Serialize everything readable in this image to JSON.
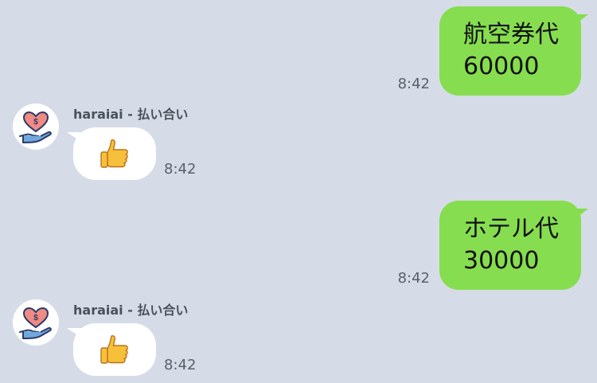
{
  "messages": [
    {
      "type": "outgoing",
      "line1": "航空券代",
      "line2": "60000",
      "time": "8:42"
    },
    {
      "type": "incoming",
      "sender": "haraiai - 払い合い",
      "content": "thumbs-up",
      "time": "8:42"
    },
    {
      "type": "outgoing",
      "line1": "ホテル代",
      "line2": "30000",
      "time": "8:42"
    },
    {
      "type": "incoming",
      "sender": "haraiai - 払い合い",
      "content": "thumbs-up",
      "time": "8:42"
    }
  ],
  "colors": {
    "background": "#d5dce7",
    "outgoing_bubble": "#86dd4f",
    "incoming_bubble": "#ffffff",
    "time_text": "#5b6068",
    "sender_text": "#4b5159"
  },
  "icons": {
    "avatar": "heart-dollar-hand-icon",
    "sticker": "thumbs-up-icon"
  }
}
